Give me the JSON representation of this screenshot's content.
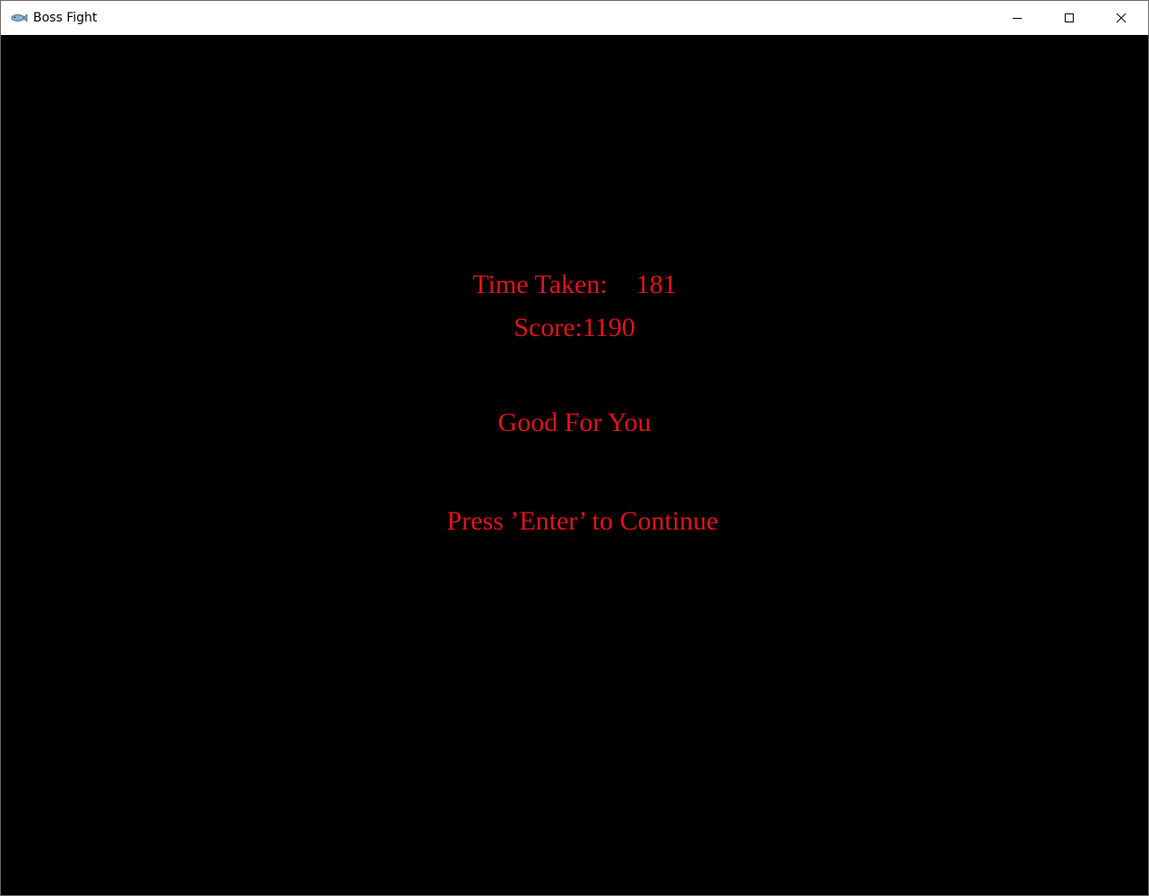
{
  "window": {
    "title": "Boss Fight",
    "app_icon": "fish-icon",
    "controls": [
      "minimize-icon",
      "maximize-icon",
      "close-icon"
    ]
  },
  "game": {
    "time_label": "Time Taken:",
    "time_value": "181",
    "score_label": "Score:",
    "score_value": "1190",
    "message": "Good For You",
    "prompt": "Press ’Enter’ to Continue",
    "text_color": "#e3131a",
    "background_color": "#000000"
  }
}
